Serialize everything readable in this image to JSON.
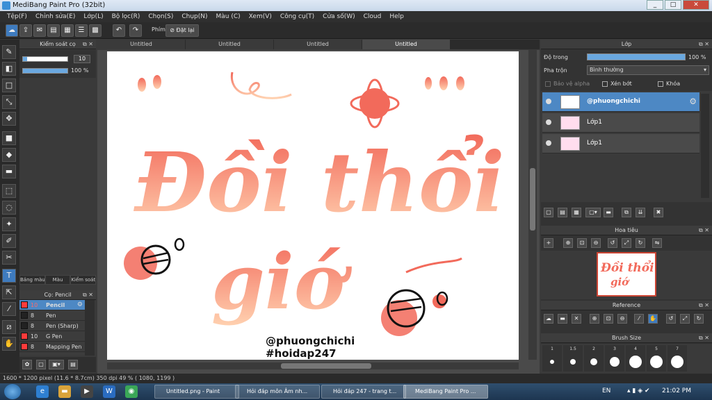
{
  "window": {
    "title": "MediBang Paint Pro (32bit)"
  },
  "menu": [
    "Tệp(F)",
    "Chỉnh sửa(E)",
    "Lớp(L)",
    "Bộ lọc(R)",
    "Chọn(S)",
    "Chụp(N)",
    "Màu (C)",
    "Xem(V)",
    "Công cụ(T)",
    "Cửa số(W)",
    "Cloud",
    "Help"
  ],
  "toolbar": {
    "key_label": "Phím",
    "reset_label": "Đặt lại"
  },
  "brush_control": {
    "title": "Kiểm soát cọ",
    "size": "10",
    "opacity": "100 %",
    "opacity_fraction": 1.0,
    "size_fraction": 0.1
  },
  "left_tabs": [
    "Bảng màu",
    "Màu",
    "Kiểm soát cọ"
  ],
  "brush_panel": {
    "title": "Cọ: Pencil",
    "items": [
      {
        "size": "10",
        "name": "Pencil",
        "color": "#ff3b3b",
        "selected": true
      },
      {
        "size": "8",
        "name": "Pen",
        "color": "#222222",
        "selected": false
      },
      {
        "size": "8",
        "name": "Pen (Sharp)",
        "color": "#222222",
        "selected": false
      },
      {
        "size": "10",
        "name": "G Pen",
        "color": "#ff3b3b",
        "selected": false
      },
      {
        "size": "8",
        "name": "Mapping Pen",
        "color": "#ff3b3b",
        "selected": false
      }
    ]
  },
  "doc_tabs": [
    "Untitled",
    "Untitled",
    "Untitled",
    "Untitled"
  ],
  "canvas": {
    "line1": "Đồi thổi",
    "line2": "giớ",
    "signature": "@phuongchichi",
    "hashtag": "#hoidap247",
    "accent": "#f26a5b",
    "accent_light": "#ffd1b0"
  },
  "layer_panel": {
    "title": "Lớp",
    "opacity_label": "Độ trong",
    "opacity_value": "100 %",
    "opacity_fraction": 1.0,
    "blend_label": "Pha trộn",
    "blend_value": "Bình thường",
    "protect_alpha": "Bảo vệ alpha",
    "clipping": "Xén bớt",
    "lock": "Khóa",
    "layers": [
      {
        "name": "@phuongchichi",
        "selected": true
      },
      {
        "name": "Lớp1",
        "selected": false
      },
      {
        "name": "Lớp1",
        "selected": false
      }
    ]
  },
  "navigator": {
    "title": "Hoa tiêu"
  },
  "reference": {
    "title": "Reference"
  },
  "brush_size": {
    "title": "Brush Size",
    "sizes": [
      "1",
      "1.5",
      "2",
      "3",
      "4",
      "5",
      "7"
    ]
  },
  "status": {
    "text": "1600 * 1200 pixel  (11.6 * 8.7cm)  350 dpi  49 %  ( 1080, 1199 )"
  },
  "taskbar": {
    "tasks": [
      "Untitled.png - Paint",
      "Hỏi đáp môn Âm nh...",
      "Hỏi đáp 247 - trang t...",
      "MediBang Paint Pro ..."
    ],
    "lang": "EN",
    "time": "21:02 PM"
  }
}
